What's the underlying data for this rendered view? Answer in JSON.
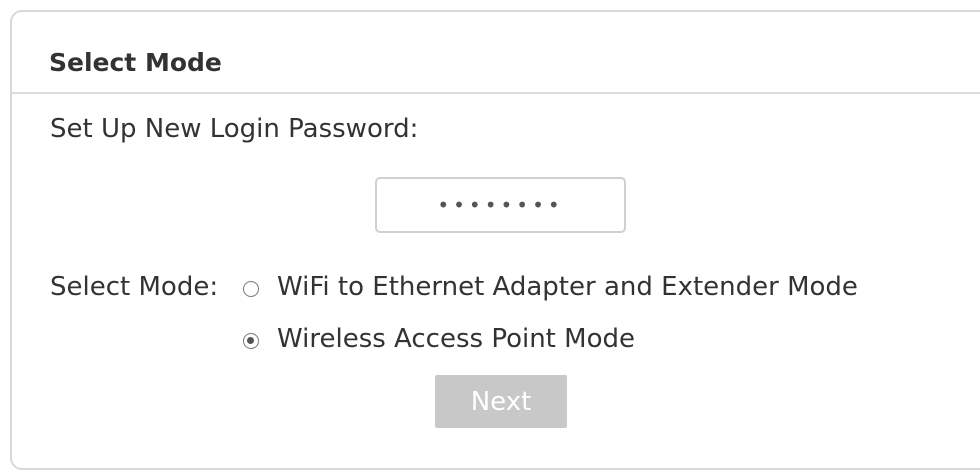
{
  "panel": {
    "title": "Select Mode"
  },
  "password": {
    "label": "Set Up New Login Password:",
    "value": "••••••••"
  },
  "mode": {
    "label": "Select Mode:",
    "options": [
      {
        "label": "WiFi to Ethernet Adapter and Extender Mode",
        "selected": false
      },
      {
        "label": "Wireless Access Point Mode",
        "selected": true
      }
    ]
  },
  "actions": {
    "next_label": "Next"
  },
  "colors": {
    "button_bg": "#c8c8c8",
    "button_text": "#ffffff",
    "border": "#d8d8d8",
    "text": "#333333"
  }
}
